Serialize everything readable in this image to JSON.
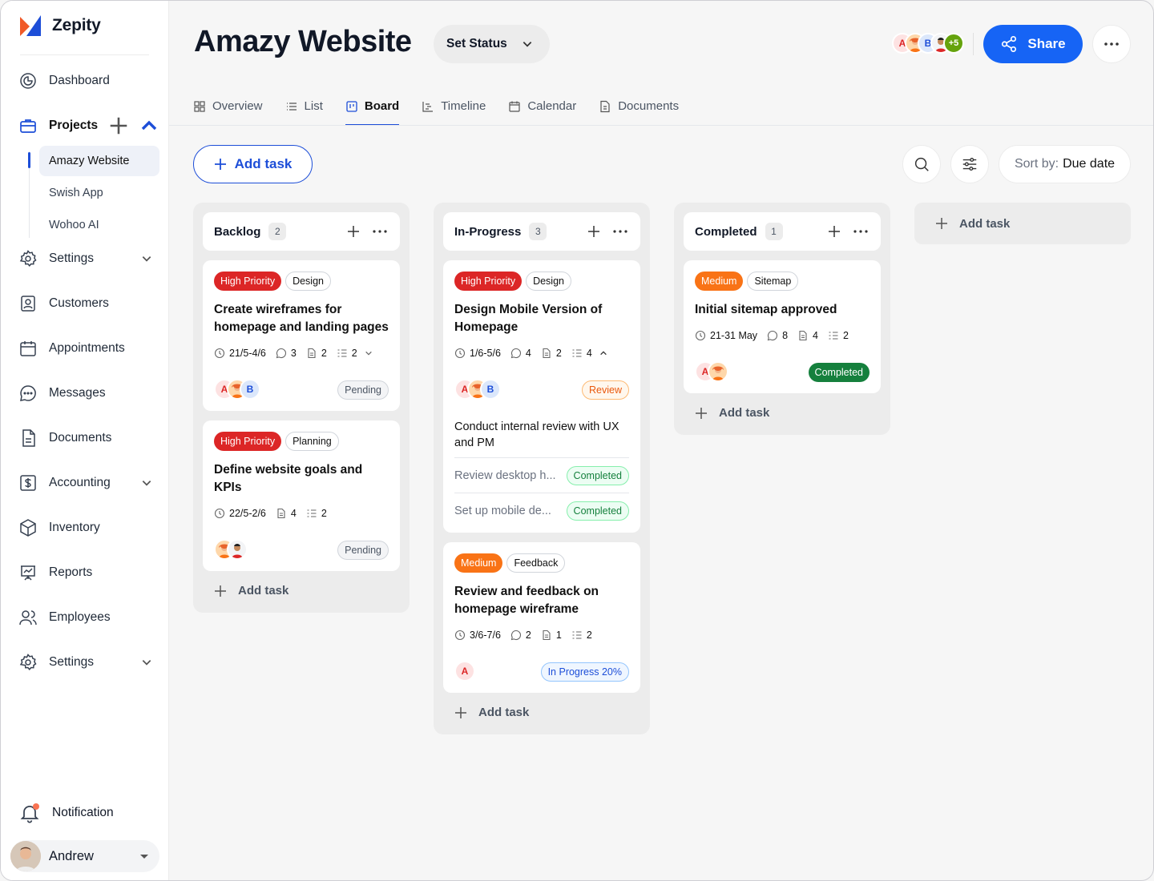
{
  "app": {
    "name": "Zepity"
  },
  "sidebar": {
    "items": [
      {
        "label": "Dashboard"
      },
      {
        "label": "Projects"
      },
      {
        "label": "Settings"
      },
      {
        "label": "Customers"
      },
      {
        "label": "Appointments"
      },
      {
        "label": "Messages"
      },
      {
        "label": "Documents"
      },
      {
        "label": "Accounting"
      },
      {
        "label": "Inventory"
      },
      {
        "label": "Reports"
      },
      {
        "label": "Employees"
      },
      {
        "label": "Settings"
      }
    ],
    "projects": [
      {
        "label": "Amazy Website"
      },
      {
        "label": "Swish App"
      },
      {
        "label": "Wohoo AI"
      }
    ],
    "notification": "Notification",
    "user": "Andrew"
  },
  "header": {
    "title": "Amazy Website",
    "set_status": "Set Status",
    "avatar_more": "+5",
    "avatar_letters": [
      "A",
      "B"
    ],
    "share": "Share"
  },
  "tabs": [
    {
      "label": "Overview"
    },
    {
      "label": "List"
    },
    {
      "label": "Board"
    },
    {
      "label": "Timeline"
    },
    {
      "label": "Calendar"
    },
    {
      "label": "Documents"
    }
  ],
  "toolbar": {
    "add_task": "Add task",
    "sort_prefix": "Sort by:",
    "sort_value": "Due date"
  },
  "columns": [
    {
      "title": "Backlog",
      "count": "2",
      "add": "Add task",
      "cards": [
        {
          "tags": [
            "High Priority",
            "Design"
          ],
          "title": "Create wireframes for homepage and landing pages",
          "date": "21/5-4/6",
          "comments": "3",
          "files": "2",
          "subtasks": "2",
          "avatars": [
            "A",
            "B"
          ],
          "status": "Pending"
        },
        {
          "tags": [
            "High Priority",
            "Planning"
          ],
          "title": "Define website goals and KPIs",
          "date": "22/5-2/6",
          "files": "4",
          "subtasks": "2",
          "status": "Pending"
        }
      ]
    },
    {
      "title": "In-Progress",
      "count": "3",
      "add": "Add task",
      "cards": [
        {
          "tags": [
            "High Priority",
            "Design"
          ],
          "title": "Design Mobile Version of Homepage",
          "date": "1/6-5/6",
          "comments": "4",
          "files": "2",
          "subtasks": "4",
          "avatars": [
            "A",
            "B"
          ],
          "status": "Review",
          "subtask_main": "Conduct internal review with UX and PM",
          "subtask_items": [
            {
              "label": "Review desktop h...",
              "status": "Completed"
            },
            {
              "label": "Set up mobile de...",
              "status": "Completed"
            }
          ]
        },
        {
          "tags": [
            "Medium",
            "Feedback"
          ],
          "title": "Review and feedback on homepage wireframe",
          "date": "3/6-7/6",
          "comments": "2",
          "files": "1",
          "subtasks": "2",
          "avatars": [
            "A"
          ],
          "status": "In Progress 20%"
        }
      ]
    },
    {
      "title": "Completed",
      "count": "1",
      "add": "Add task",
      "cards": [
        {
          "tags": [
            "Medium",
            "Sitemap"
          ],
          "title": "Initial sitemap approved",
          "date": "21-31 May",
          "comments": "8",
          "files": "4",
          "subtasks": "2",
          "avatars": [
            "A"
          ],
          "status": "Completed"
        }
      ]
    }
  ],
  "add_column": "Add task",
  "colors": {
    "accent": "#1664f5",
    "high_priority": "#dc2626",
    "medium": "#f97316",
    "completed": "#15803d"
  }
}
